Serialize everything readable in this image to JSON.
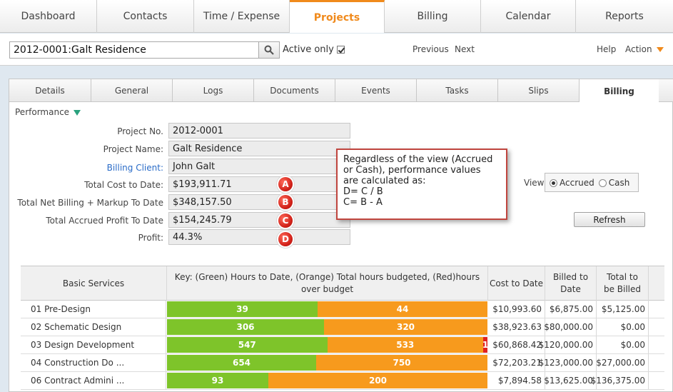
{
  "topnav": {
    "tabs": [
      {
        "label": "Dashboard"
      },
      {
        "label": "Contacts"
      },
      {
        "label": "Time / Expense"
      },
      {
        "label": "Projects"
      },
      {
        "label": "Billing"
      },
      {
        "label": "Calendar"
      },
      {
        "label": "Reports"
      }
    ],
    "active": "Projects"
  },
  "search": {
    "value": "2012-0001:Galt Residence",
    "active_only_label": "Active only",
    "active_only_checked": true,
    "previous": "Previous",
    "next": "Next",
    "help": "Help",
    "action": "Action"
  },
  "subtabs": {
    "tabs": [
      {
        "label": "Details"
      },
      {
        "label": "General"
      },
      {
        "label": "Logs"
      },
      {
        "label": "Documents"
      },
      {
        "label": "Events"
      },
      {
        "label": "Tasks"
      },
      {
        "label": "Slips"
      },
      {
        "label": "Billing"
      }
    ],
    "active": "Billing"
  },
  "performance": {
    "title": "Performance",
    "fields": [
      {
        "label": "Project No.",
        "value": "2012-0001",
        "link": false,
        "badge": ""
      },
      {
        "label": "Project Name:",
        "value": "Galt Residence",
        "link": false,
        "badge": ""
      },
      {
        "label": "Billing Client:",
        "value": "John Galt",
        "link": true,
        "badge": ""
      },
      {
        "label": "Total Cost to Date:",
        "value": "$193,911.71",
        "link": false,
        "badge": "A"
      },
      {
        "label": "Total Net Billing + Markup To Date",
        "value": "$348,157.50",
        "link": false,
        "badge": "B"
      },
      {
        "label": "Total Accrued Profit To Date",
        "value": "$154,245.79",
        "link": false,
        "badge": "C"
      },
      {
        "label": "Profit:",
        "value": "44.3%",
        "link": false,
        "badge": "D"
      }
    ],
    "callout": {
      "lines": [
        "Regardless of the view (Accrued",
        "or Cash), performance values",
        "are calculated as:",
        "D= C / B",
        "C= B - A"
      ]
    },
    "view": {
      "label": "View",
      "options": [
        "Accrued",
        "Cash"
      ],
      "selected": "Accrued"
    },
    "refresh": "Refresh"
  },
  "table": {
    "headers": {
      "services": "Basic Services",
      "key": "Key: (Green) Hours to Date, (Orange) Total hours budgeted, (Red)hours over budget",
      "cost": "Cost to Date",
      "billed": "Billed to Date",
      "to_be_billed": "Total to be Billed"
    },
    "colors": {
      "green": "#7ec42a",
      "orange": "#f79a1d",
      "red": "#e02020"
    },
    "rows": [
      {
        "name": "01 Pre-Design",
        "hours": "39",
        "budget": "44",
        "over": "",
        "hours_share": 0.469,
        "budget_share": 0.531,
        "over_share": 0,
        "cost": "$10,993.60",
        "billed": "$6,875.00",
        "to_be_billed": "$5,125.00"
      },
      {
        "name": "02 Schematic Design",
        "hours": "306",
        "budget": "320",
        "over": "",
        "hours_share": 0.489,
        "budget_share": 0.511,
        "over_share": 0,
        "cost": "$38,923.63",
        "billed": "$80,000.00",
        "to_be_billed": "$0.00"
      },
      {
        "name": "03 Design Development",
        "hours": "547",
        "budget": "533",
        "over": "1",
        "hours_share": 0.5,
        "budget_share": 0.487,
        "over_share": 0.013,
        "cost": "$60,868.42",
        "billed": "$120,000.00",
        "to_be_billed": "$0.00"
      },
      {
        "name": "04 Construction Do ...",
        "hours": "654",
        "budget": "750",
        "over": "",
        "hours_share": 0.466,
        "budget_share": 0.534,
        "over_share": 0,
        "cost": "$72,203.21",
        "billed": "$123,000.00",
        "to_be_billed": "$27,000.00"
      },
      {
        "name": "06 Contract Admini ...",
        "hours": "93",
        "budget": "200",
        "over": "",
        "hours_share": 0.317,
        "budget_share": 0.683,
        "over_share": 0,
        "cost": "$7,894.58",
        "billed": "$13,625.00",
        "to_be_billed": "$136,375.00"
      }
    ]
  }
}
